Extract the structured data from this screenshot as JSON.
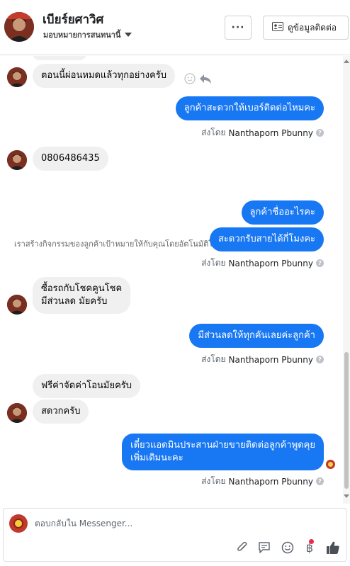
{
  "header": {
    "name": "เบียร์ยศาวิศ",
    "subtitle": "มอบหมายการสนทนานี้",
    "more_label": "···",
    "contact_label": "ดูข้อมูลติดต่อ"
  },
  "messages": {
    "m1": "ตอนนี้ผ่อนหมดแล้วทุกอย่างครับ",
    "m2": "ลูกค้าสะดวกให้เบอร์ติดต่อไหมคะ",
    "m3": "0806486435",
    "m4": "ลูกค้าชื่ออะไรคะ",
    "m5": "สะดวกรับสายได้กี่โมงคะ",
    "m6_line1": "ซื้อรถกับโชคคูนโชค",
    "m6_line2": "มีส่วนลด มัยครับ",
    "m7": "มีส่วนลดให้ทุกคันเลยค่ะลูกค้า",
    "m8": "ฟรีค่าจัดค่าโอนมัยครับ",
    "m9": "สดวกครับ",
    "m10_line1": "เดี๋ยวแอดมินประสานฝ่ายขายติดต่อลูกค้าพูดคุย",
    "m10_line2": "เพิ่มเติมนะคะ"
  },
  "system_note": "เราสร้างกิจกรรมของลูกค้าเป้าหมายให้กับคุณโดยอัตโนมัติโดยอิงตามการสนทนานี้",
  "sent_by": {
    "prefix": "ส่งโดย",
    "name": "Nanthaporn Pbunny",
    "help": "?"
  },
  "composer": {
    "placeholder": "ตอบกลับใน Messenger..."
  },
  "colors": {
    "outgoing": "#1877f2",
    "incoming": "#f1f0f0",
    "notification_dot": "#f02849"
  },
  "icons": [
    "smile-icon",
    "reply-icon",
    "contact-card-icon",
    "attach-icon",
    "saved-reply-icon",
    "emoji-icon",
    "payment-icon",
    "like-icon"
  ]
}
